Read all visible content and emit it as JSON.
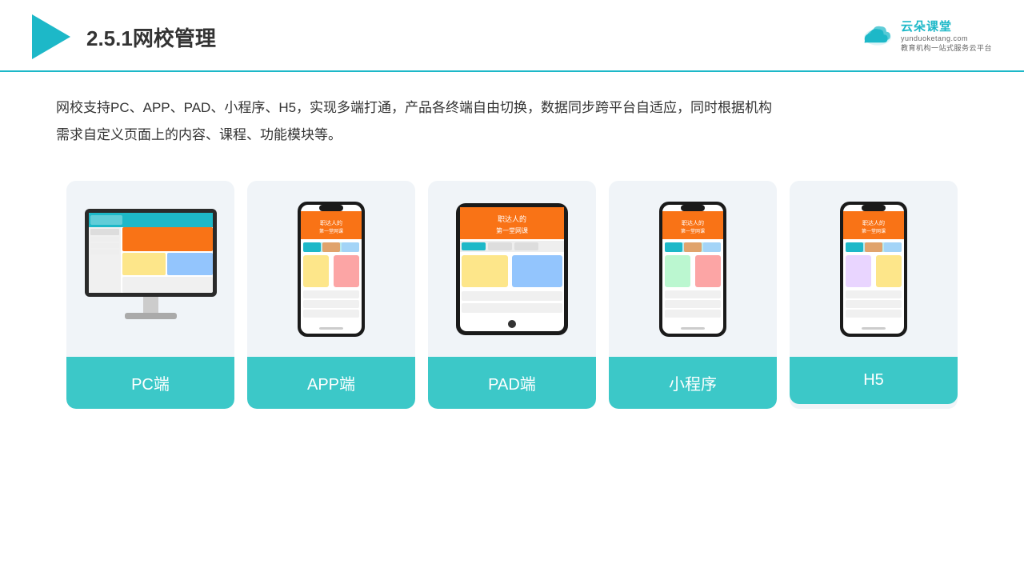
{
  "header": {
    "title": "2.5.1网校管理",
    "brand_name": "云朵课堂",
    "brand_url": "yunduoketang.com",
    "brand_tagline": "教育机构一站式服务云平台"
  },
  "description": {
    "text": "网校支持PC、APP、PAD、小程序、H5，实现多端打通，产品各终端自由切换，数据同步跨平台自适应，同时根据机构需求自定义页面上的内容、课程、功能模块等。"
  },
  "cards": [
    {
      "id": "pc",
      "label": "PC端"
    },
    {
      "id": "app",
      "label": "APP端"
    },
    {
      "id": "pad",
      "label": "PAD端"
    },
    {
      "id": "mini",
      "label": "小程序"
    },
    {
      "id": "h5",
      "label": "H5"
    }
  ],
  "accent_color": "#3cc8c8",
  "bg_card": "#eef2f7"
}
